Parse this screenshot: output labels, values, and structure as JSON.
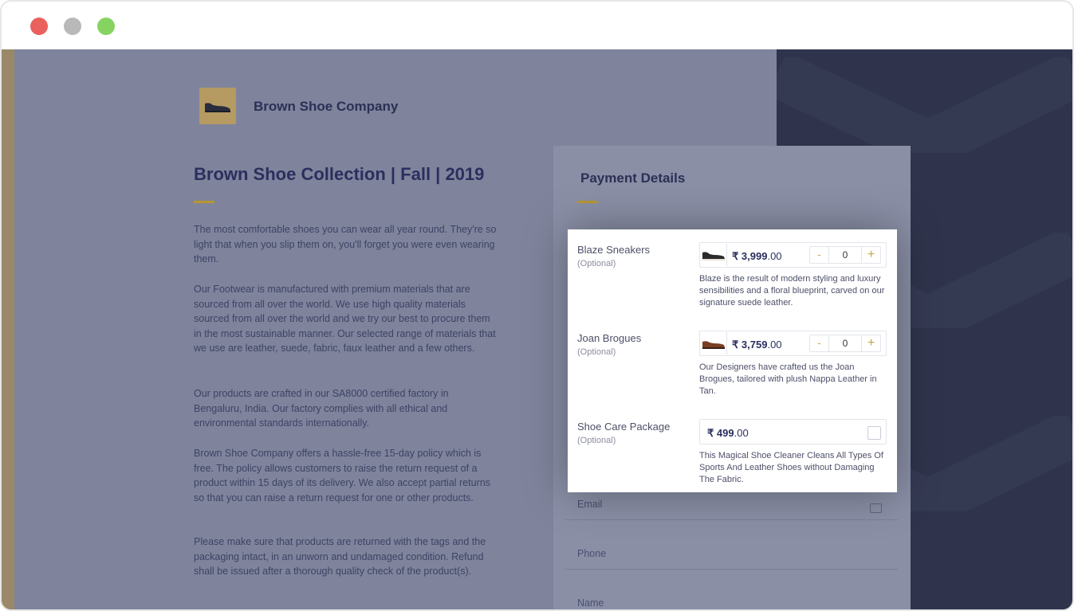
{
  "window": {
    "controls": [
      "close",
      "minimize",
      "maximize"
    ]
  },
  "store": {
    "name": "Brown Shoe Company",
    "logo_icon": "shoe-logo-icon"
  },
  "collection": {
    "title": "Brown Shoe Collection | Fall | 2019",
    "paragraphs": [
      "The most comfortable shoes you can wear all year round. They're so light that when you slip them on, you'll forget you were even wearing them.",
      "Our Footwear is manufactured with premium materials that are sourced from all over the world. We use high quality materials sourced from all over the world and we try our best to procure them in the most sustainable manner. Our selected range of materials that we use are leather, suede, fabric, faux leather and a few others.",
      "Our products are crafted in our SA8000 certified factory in Bengaluru, India. Our factory complies with all ethical and environmental standards internationally.",
      "Brown Shoe Company offers a hassle-free 15-day policy which is free. The policy allows customers to raise the return request of a product within 15 days of its delivery. We also accept partial returns so that you can raise a return request for one or other products.",
      "Please make sure that products are returned with the tags and the packaging intact, in an unworn and undamaged condition. Refund shall be issued after a thorough quality check of the product(s)."
    ]
  },
  "payment": {
    "title": "Payment Details",
    "fields": {
      "email": "Email",
      "phone": "Phone",
      "name": "Name"
    }
  },
  "items": [
    {
      "name": "Blaze Sneakers",
      "optional": "(Optional)",
      "currency": "₹",
      "price_main": "3,999",
      "price_decimal": ".00",
      "quantity": "0",
      "minus": "-",
      "plus": "+",
      "description": "Blaze is the result of modern styling and luxury sensibilities and a floral blueprint, carved on our signature suede leather."
    },
    {
      "name": "Joan Brogues",
      "optional": "(Optional)",
      "currency": "₹",
      "price_main": "3,759",
      "price_decimal": ".00",
      "quantity": "0",
      "minus": "-",
      "plus": "+",
      "description": "Our Designers have crafted us the Joan Brogues, tailored with plush Nappa Leather in Tan."
    },
    {
      "name": "Shoe Care Package",
      "optional": "(Optional)",
      "currency": "₹",
      "price_main": "499",
      "price_decimal": ".00",
      "checked": false,
      "description": "This Magical Shoe Cleaner Cleans All Types Of Sports And Leather Shoes without Damaging The Fabric."
    }
  ],
  "colors": {
    "accent": "#b8972e",
    "heading": "#2b2f5e",
    "dark_panel": "#2f344c"
  }
}
